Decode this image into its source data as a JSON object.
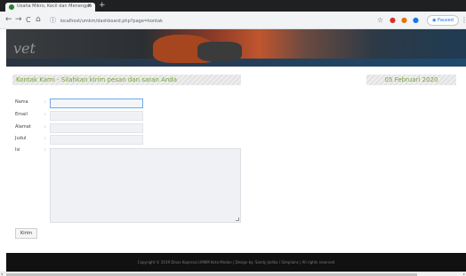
{
  "browser": {
    "tab_title": "Usaha Mikro, Kecil dan Menengah",
    "tab_close": "×",
    "new_tab": "+",
    "back": "←",
    "forward": "→",
    "reload": "C",
    "home": "⌂",
    "info": "ⓘ",
    "url": "localhost/umkm/dashboard.php?page=kontak",
    "star": "☆",
    "paused_label": "Paused",
    "menu": "⋮"
  },
  "banner": {
    "sign_text": "vet"
  },
  "contact": {
    "heading": "Kontak Kami - Silahkan kirim pesan dan saran Anda",
    "date": "05 Februari 2020",
    "fields": [
      {
        "label": "Nama",
        "colon": ":",
        "value": ""
      },
      {
        "label": "Email",
        "colon": ":",
        "value": ""
      },
      {
        "label": "Alamat",
        "colon": ":",
        "value": ""
      },
      {
        "label": "Judul",
        "colon": ":",
        "value": ""
      },
      {
        "label": "Isi",
        "colon": ":",
        "value": ""
      }
    ],
    "submit_label": "Kirim"
  },
  "footer": {
    "text": "Copyright © 2019 Dinas Koperasi UMKM Kota Medan | Design by: Sandy Jodika / Simplians | All rights reserved"
  },
  "colors": {
    "accent_green": "#7aa336",
    "footer_bg": "#111111",
    "active_border": "#6fa8e8"
  }
}
